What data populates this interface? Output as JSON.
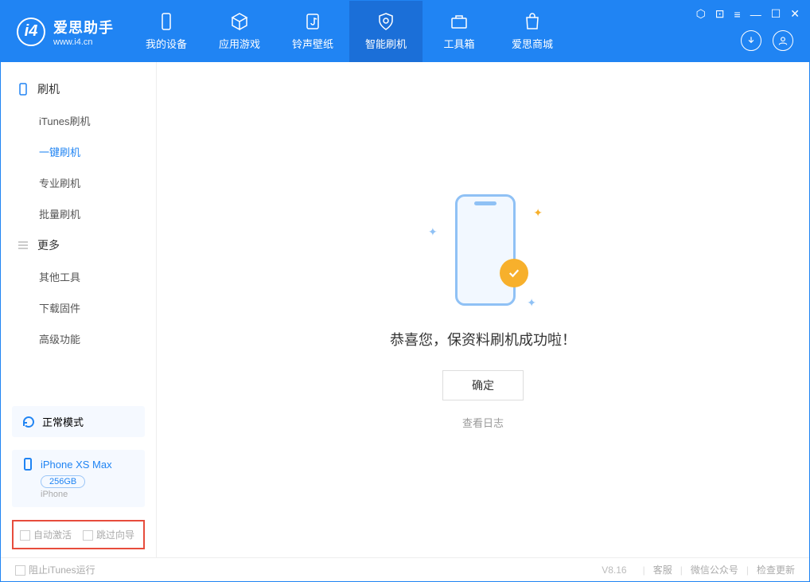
{
  "app": {
    "name": "爱思助手",
    "domain": "www.i4.cn"
  },
  "tabs": [
    {
      "label": "我的设备"
    },
    {
      "label": "应用游戏"
    },
    {
      "label": "铃声壁纸"
    },
    {
      "label": "智能刷机"
    },
    {
      "label": "工具箱"
    },
    {
      "label": "爱思商城"
    }
  ],
  "sidebar": {
    "flash_section": "刷机",
    "flash_items": [
      "iTunes刷机",
      "一键刷机",
      "专业刷机",
      "批量刷机"
    ],
    "more_section": "更多",
    "more_items": [
      "其他工具",
      "下载固件",
      "高级功能"
    ]
  },
  "mode": {
    "label": "正常模式"
  },
  "device": {
    "name": "iPhone XS Max",
    "storage": "256GB",
    "subtype": "iPhone"
  },
  "options": {
    "auto_activate": "自动激活",
    "skip_guide": "跳过向导"
  },
  "main": {
    "success_msg": "恭喜您，保资料刷机成功啦！",
    "ok_btn": "确定",
    "log_link": "查看日志"
  },
  "footer": {
    "block_itunes": "阻止iTunes运行",
    "version": "V8.16",
    "links": [
      "客服",
      "微信公众号",
      "检查更新"
    ]
  }
}
